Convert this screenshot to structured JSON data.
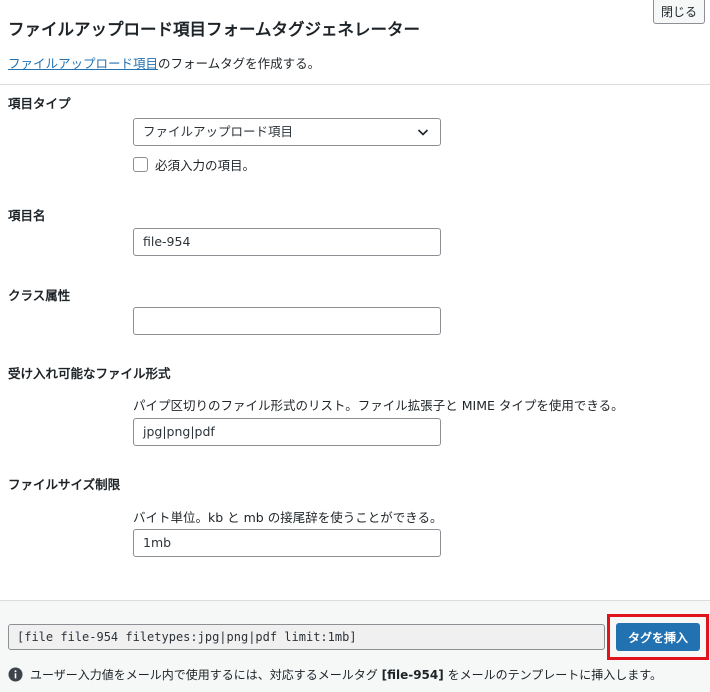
{
  "dialog": {
    "close_label": "閉じる",
    "title": "ファイルアップロード項目フォームタグジェネレーター",
    "description_link": "ファイルアップロード項目",
    "description_rest": "のフォームタグを作成する。"
  },
  "fields": {
    "type": {
      "label": "項目タイプ",
      "selected": "ファイルアップロード項目",
      "required_label": "必須入力の項目。",
      "required_checked": false
    },
    "name": {
      "label": "項目名",
      "value": "file-954"
    },
    "class": {
      "label": "クラス属性",
      "value": ""
    },
    "filetypes": {
      "label": "受け入れ可能なファイル形式",
      "help": "パイプ区切りのファイル形式のリスト。ファイル拡張子と MIME タイプを使用できる。",
      "value": "jpg|png|pdf"
    },
    "limit": {
      "label": "ファイルサイズ制限",
      "help": "バイト単位。kb と mb の接尾辞を使うことができる。",
      "value": "1mb"
    }
  },
  "footer": {
    "tag": "[file file-954 filetypes:jpg|png|pdf limit:1mb]",
    "insert_label": "タグを挿入",
    "note_before": "ユーザー入力値をメール内で使用するには、対応するメールタグ",
    "note_tag": "[file-954]",
    "note_after": "をメールのテンプレートに挿入します。",
    "highlight_color": "#e0141c",
    "accent_color": "#2271b1"
  },
  "icons": {
    "select": "chevron-down-icon",
    "info": "info-icon"
  }
}
